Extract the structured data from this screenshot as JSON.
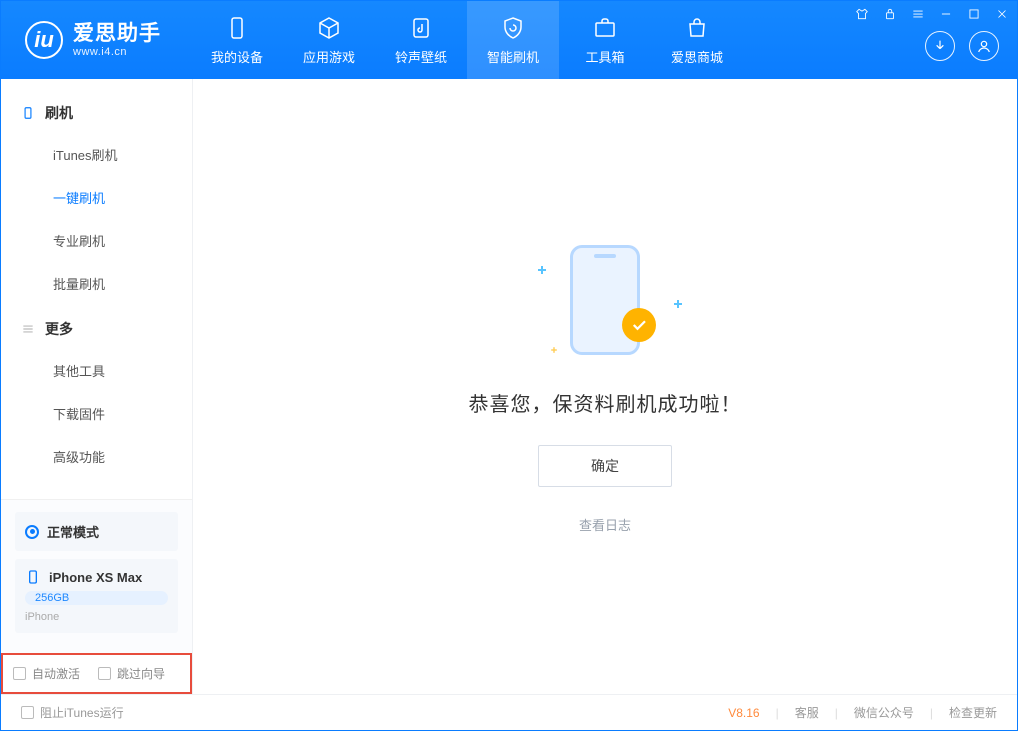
{
  "app": {
    "title": "爱思助手",
    "subtitle": "www.i4.cn"
  },
  "nav": {
    "device": "我的设备",
    "apps": "应用游戏",
    "ringtones": "铃声壁纸",
    "flash": "智能刷机",
    "toolbox": "工具箱",
    "store": "爱思商城"
  },
  "sidebar": {
    "group_flash": "刷机",
    "items_flash": {
      "itunes": "iTunes刷机",
      "oneclick": "一键刷机",
      "pro": "专业刷机",
      "batch": "批量刷机"
    },
    "group_more": "更多",
    "items_more": {
      "other": "其他工具",
      "firmware": "下载固件",
      "advanced": "高级功能"
    }
  },
  "device": {
    "mode": "正常模式",
    "name": "iPhone XS Max",
    "storage": "256GB",
    "type": "iPhone"
  },
  "checks": {
    "auto_activate": "自动激活",
    "skip_guide": "跳过向导"
  },
  "main": {
    "success": "恭喜您，保资料刷机成功啦！",
    "ok": "确定",
    "view_log": "查看日志"
  },
  "footer": {
    "block_itunes": "阻止iTunes运行",
    "version": "V8.16",
    "support": "客服",
    "wechat": "微信公众号",
    "update": "检查更新"
  }
}
